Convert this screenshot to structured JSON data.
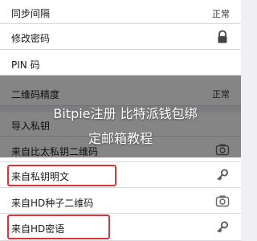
{
  "settings": {
    "rows": [
      {
        "label": "同步间隔",
        "value": "正常"
      },
      {
        "label": "修改密码",
        "icon": "lock-icon"
      },
      {
        "label": "PIN 码"
      },
      {
        "label": "二维码精度",
        "value": "正常"
      },
      {
        "label": "导入私钥"
      },
      {
        "label": "来自比太私钥二维码",
        "icon": "camera-icon"
      },
      {
        "label": "来自私钥明文",
        "icon": "key-icon"
      },
      {
        "label": "来自HD种子二维码",
        "icon": "camera-icon"
      },
      {
        "label": "来自HD密语",
        "icon": "key-icon"
      }
    ]
  },
  "watermark": {
    "line1": "Bitpie注册 比特派钱包绑",
    "line2": "定邮箱教程"
  },
  "colors": {
    "highlight": "#d9343a",
    "overlay": "rgba(0,0,0,0.48)"
  }
}
